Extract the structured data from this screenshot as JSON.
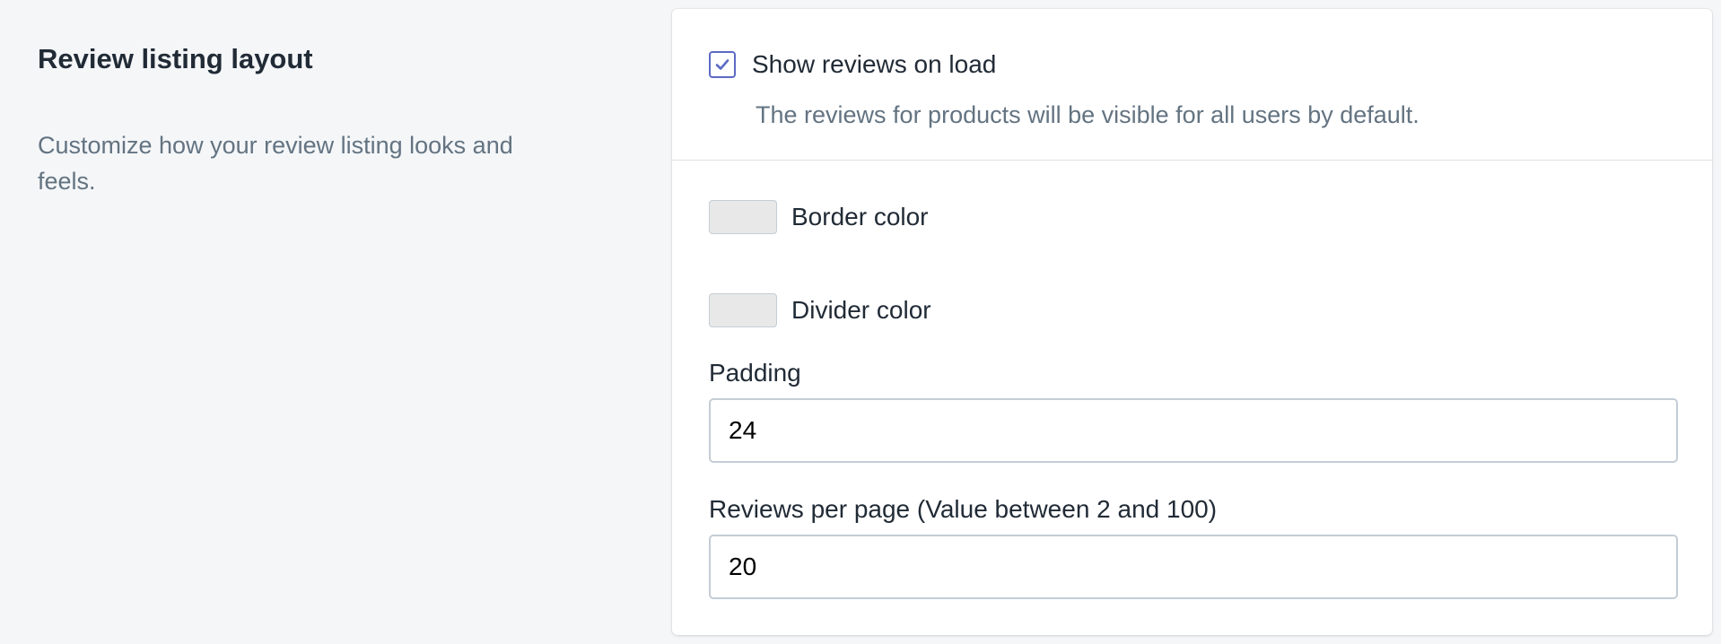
{
  "annotation": {
    "title": "Review listing layout",
    "description": "Customize how your review listing looks and feels."
  },
  "show_reviews": {
    "label": "Show reviews on load",
    "checked": true,
    "help_text": "The reviews for products will be visible for all users by default."
  },
  "border_color": {
    "label": "Border color",
    "value": "#e8e8e8"
  },
  "divider_color": {
    "label": "Divider color",
    "value": "#e8e8e8"
  },
  "padding": {
    "label": "Padding",
    "value": "24"
  },
  "reviews_per_page": {
    "label": "Reviews per page (Value between 2 and 100)",
    "value": "20"
  },
  "colors": {
    "checkbox_accent": "#5c6ac4",
    "page_background": "#f4f6f8",
    "subdued_text": "#637381"
  }
}
